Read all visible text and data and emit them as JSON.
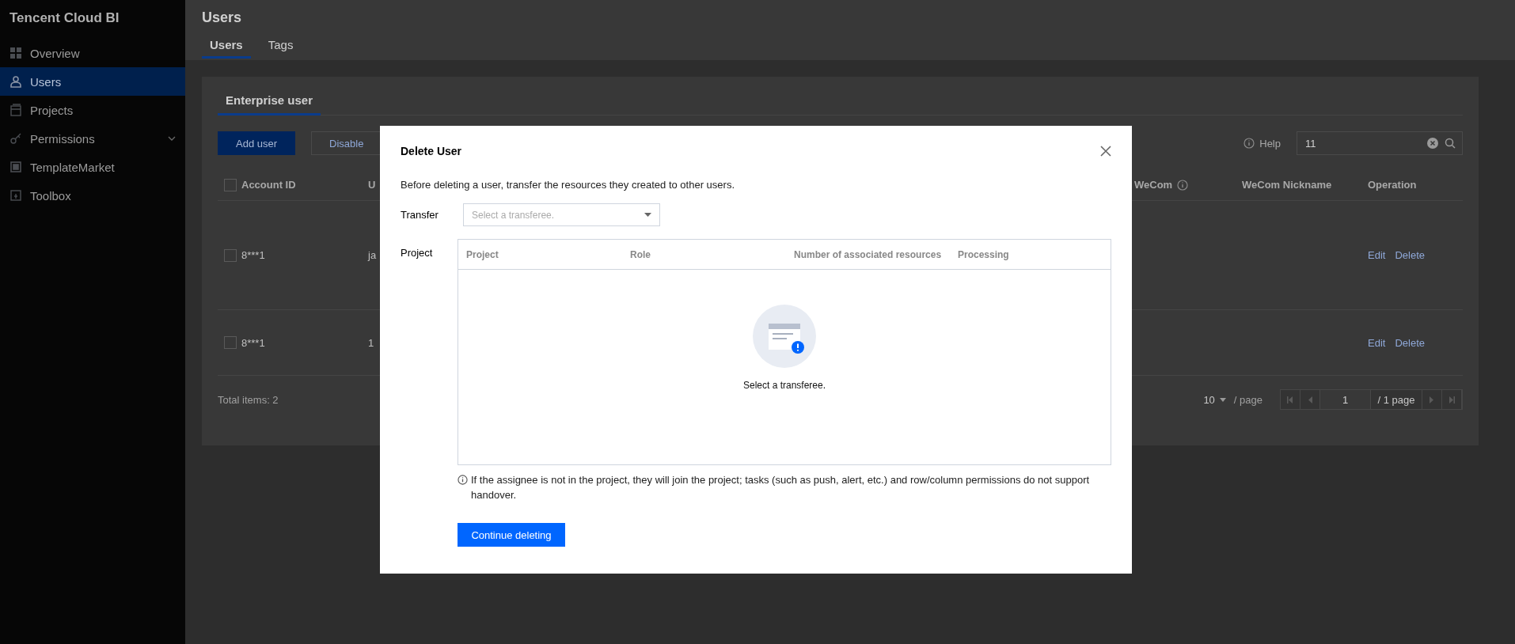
{
  "sidebar": {
    "brand": "Tencent Cloud BI",
    "items": [
      {
        "label": "Overview",
        "selected": false,
        "expandable": false
      },
      {
        "label": "Users",
        "selected": true,
        "expandable": false
      },
      {
        "label": "Projects",
        "selected": false,
        "expandable": false
      },
      {
        "label": "Permissions",
        "selected": false,
        "expandable": true
      },
      {
        "label": "TemplateMarket",
        "selected": false,
        "expandable": false
      },
      {
        "label": "Toolbox",
        "selected": false,
        "expandable": false
      }
    ]
  },
  "page": {
    "title": "Users",
    "tabs": [
      {
        "label": "Users",
        "selected": true
      },
      {
        "label": "Tags",
        "selected": false
      }
    ]
  },
  "card": {
    "tabs": [
      {
        "label": "Enterprise user",
        "selected": true
      }
    ],
    "buttons": [
      {
        "label": "Add user",
        "kind": "primary"
      },
      {
        "label": "Disable",
        "kind": "secondary"
      }
    ],
    "help": "Help",
    "search": {
      "value": "11"
    },
    "table": {
      "header_checked": false,
      "columns": [
        {
          "label": "Account ID",
          "info": false
        },
        {
          "label": "U"
        },
        {
          "label": "WeCom",
          "info": true
        },
        {
          "label": "WeCom Nickname",
          "info": false
        },
        {
          "label": "Operation",
          "info": false
        }
      ],
      "rows": [
        {
          "checked": false,
          "cells": [
            "8***1",
            "ja"
          ],
          "actions": [
            "Edit",
            "Delete"
          ]
        },
        {
          "checked": false,
          "cells": [
            "8***1",
            "1"
          ],
          "actions": [
            "Edit",
            "Delete"
          ]
        }
      ]
    },
    "total": "Total items:  2",
    "pagination": {
      "page_size": "10",
      "per_page": "/ page",
      "page": "1",
      "pages": "/ 1 page"
    }
  },
  "dialog": {
    "title": "Delete User",
    "description": "Before deleting a user, transfer the resources they created to other users.",
    "transfer": {
      "label": "Transfer",
      "placeholder": "Select a transferee."
    },
    "project": {
      "label": "Project",
      "columns": [
        "Project",
        "Role",
        "Number of associated resources",
        "Processing"
      ],
      "empty_text": "Select a transferee."
    },
    "note": "If the assignee is not in the project, they will join the project; tasks (such as push, alert, etc.) and row/column permissions do not support handover.",
    "button": "Continue deleting"
  }
}
